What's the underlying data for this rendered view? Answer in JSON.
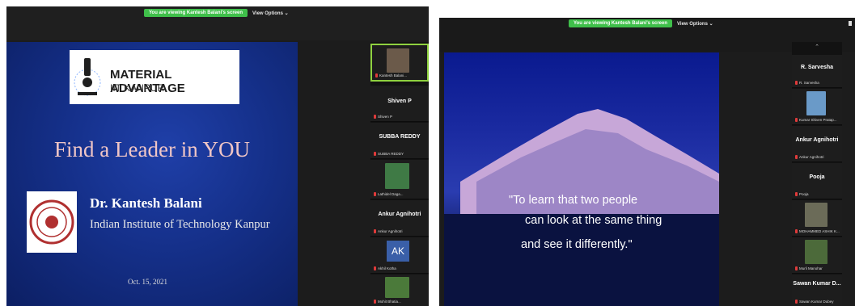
{
  "left_window": {
    "banner": {
      "viewing": "You are viewing Kantesh Balani's screen",
      "view_options": "View Options ⌄"
    },
    "slide": {
      "logo_title": "MATERIAL ADVANTAGE",
      "logo_sub": "IIT KANPUR",
      "title": "Find a Leader in YOU",
      "presenter": "Dr. Kantesh Balani",
      "institute": "Indian Institute of Technology Kanpur",
      "date": "Oct. 15, 2021"
    },
    "gallery": [
      {
        "name": "",
        "tag": "Kantesh Balani..."
      },
      {
        "name": "Shiven P",
        "tag": "Shiven P"
      },
      {
        "name": "SUBBA REDDY",
        "tag": "SUBBA REDDY"
      },
      {
        "name": "",
        "tag": "Lathidel Daga..."
      },
      {
        "name": "Ankur Agnihotri",
        "tag": "Ankur Agnihotri"
      },
      {
        "name": "AK",
        "tag": "Akhil Kotha"
      },
      {
        "name": "",
        "tag": "Mohit Bhatia..."
      }
    ]
  },
  "right_window": {
    "banner": {
      "viewing": "You are viewing Kantesh Balani's screen",
      "view_options": "View Options ⌄"
    },
    "quote": {
      "line1": "\"To learn that two people",
      "line2": "can look at the same thing",
      "line3": "and see it differently.\""
    },
    "gallery": [
      {
        "name": "R. Sarvesha",
        "tag": "R. Sarvesha"
      },
      {
        "name": "",
        "tag": "Kumar Shiven Pratap..."
      },
      {
        "name": "Ankur Agnihotri",
        "tag": "Ankur Agnihotri"
      },
      {
        "name": "Pooja",
        "tag": "Pooja"
      },
      {
        "name": "",
        "tag": "MOHAMMED ASHIK K..."
      },
      {
        "name": "",
        "tag": "Murli Manohar"
      },
      {
        "name": "Sawan Kumar D...",
        "tag": "Sawan Kumar Dubey"
      }
    ]
  },
  "colors": {
    "banner_green": "#3fbf4a",
    "slide_blue": "#15308a",
    "mic_red": "#e03a3a"
  }
}
